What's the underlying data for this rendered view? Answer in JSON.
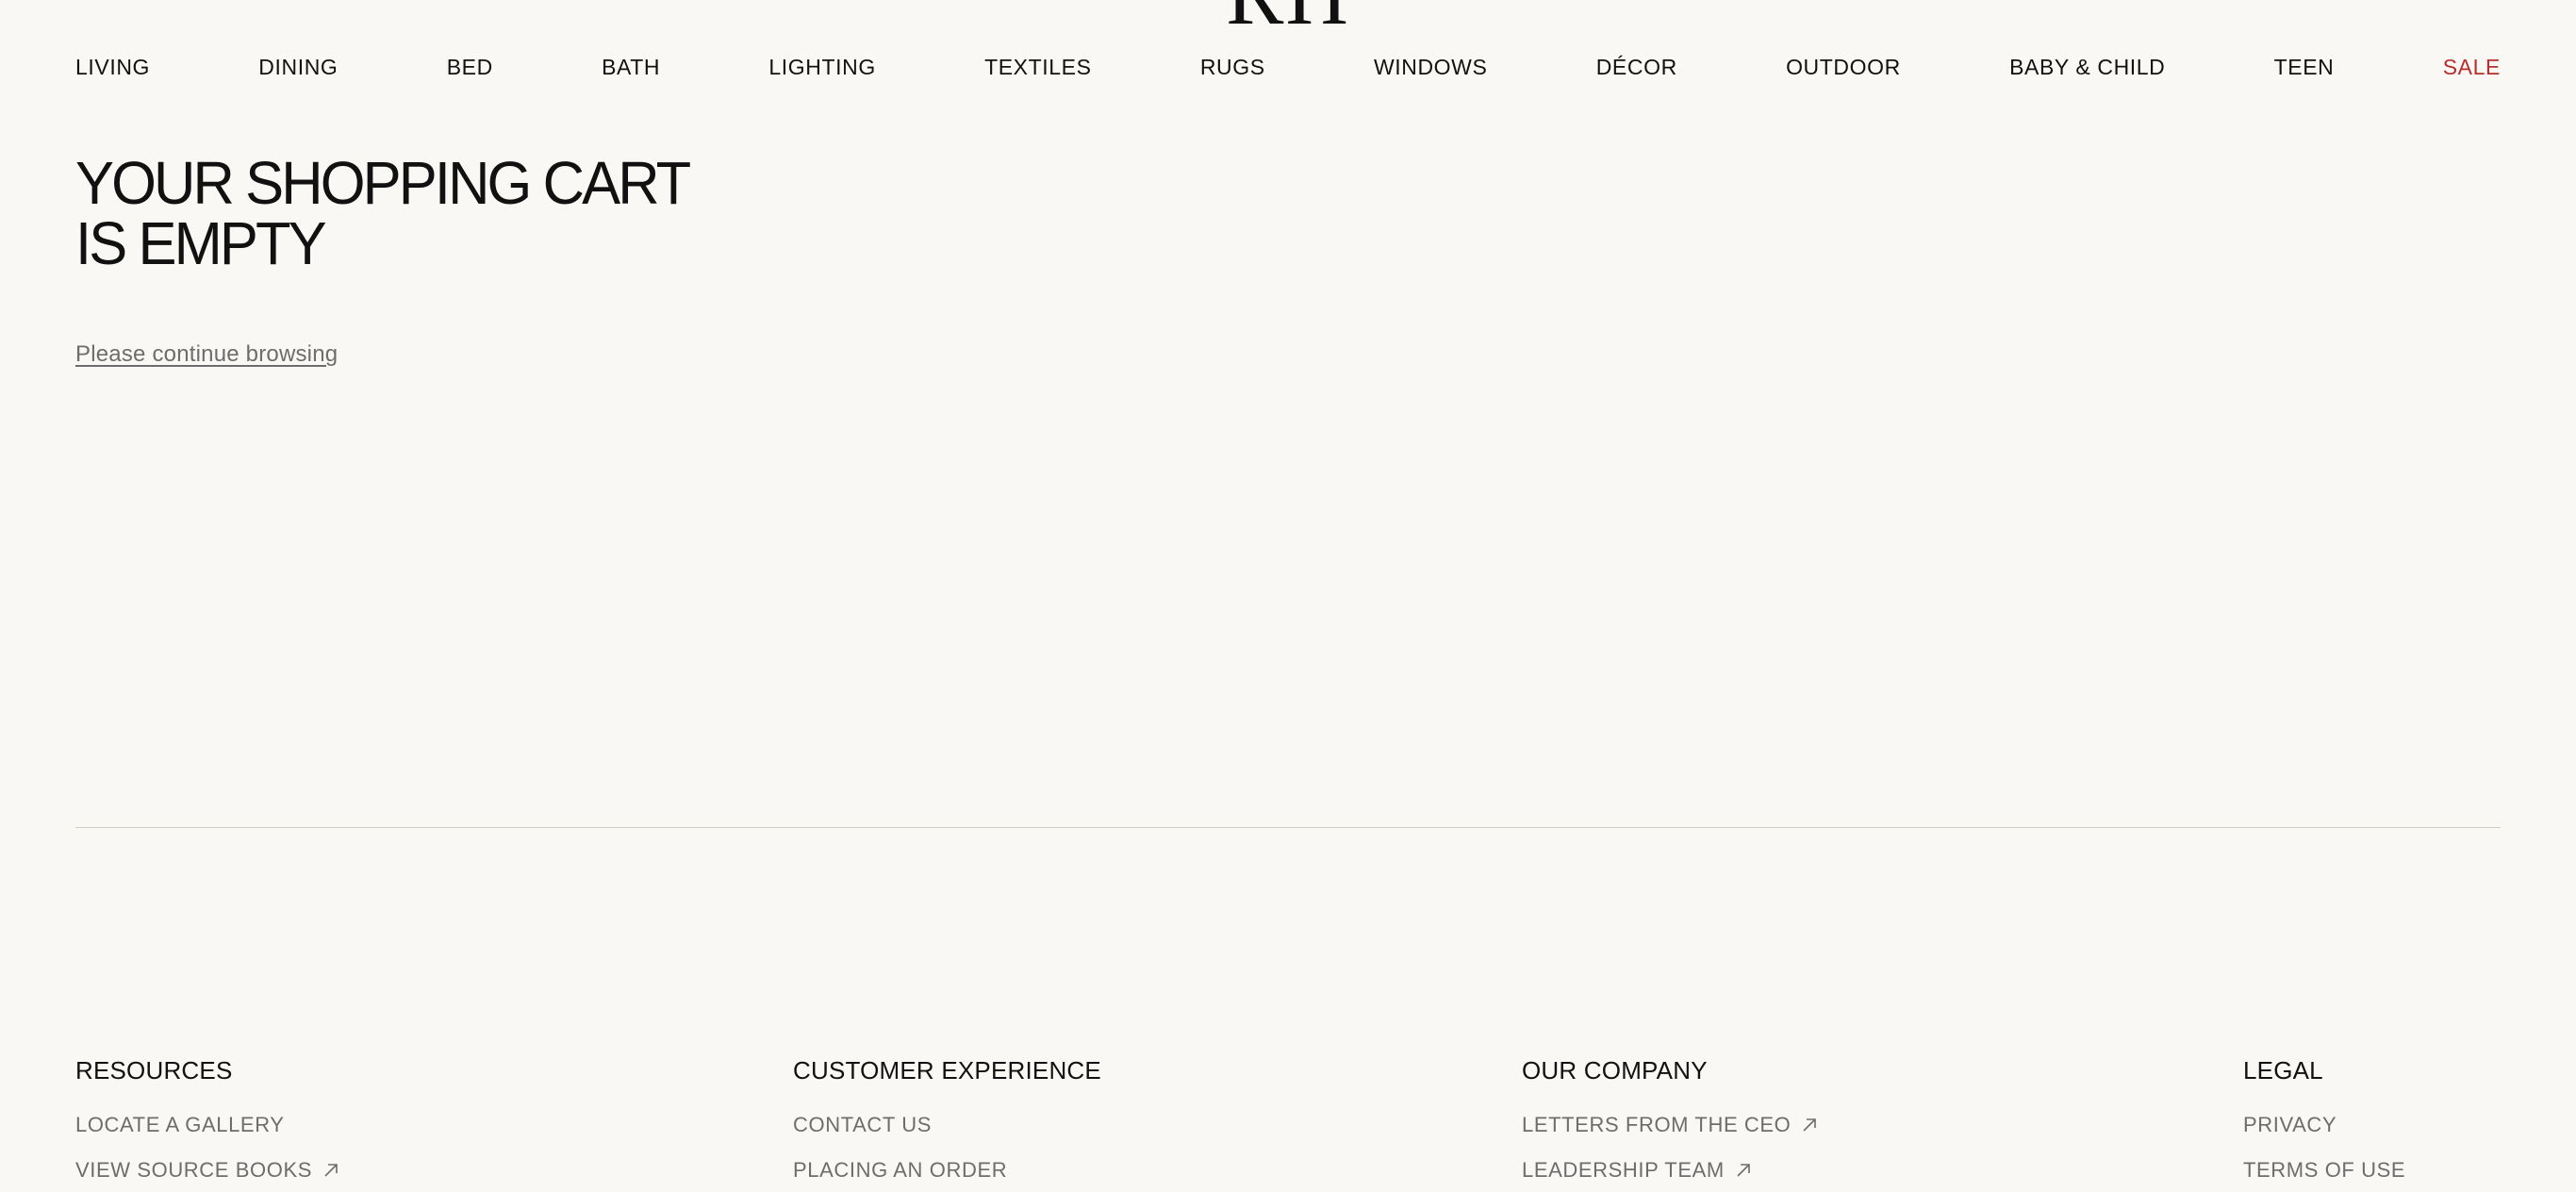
{
  "brand": {
    "logo_text": "RH"
  },
  "nav": {
    "items": [
      {
        "label": "LIVING"
      },
      {
        "label": "DINING"
      },
      {
        "label": "BED"
      },
      {
        "label": "BATH"
      },
      {
        "label": "LIGHTING"
      },
      {
        "label": "TEXTILES"
      },
      {
        "label": "RUGS"
      },
      {
        "label": "WINDOWS"
      },
      {
        "label": "DÉCOR"
      },
      {
        "label": "OUTDOOR"
      },
      {
        "label": "BABY & CHILD"
      },
      {
        "label": "TEEN"
      },
      {
        "label": "SALE"
      }
    ],
    "sale_color": "#b92d2d"
  },
  "cart": {
    "title": "YOUR SHOPPING CART IS EMPTY",
    "continue_link": "Please continue browsing"
  },
  "footer": {
    "columns": [
      {
        "heading": "RESOURCES",
        "links": [
          {
            "label": "LOCATE A GALLERY",
            "icon": ""
          },
          {
            "label": "VIEW SOURCE BOOKS",
            "icon": "external-link-icon"
          }
        ]
      },
      {
        "heading": "CUSTOMER EXPERIENCE",
        "links": [
          {
            "label": "CONTACT US",
            "icon": ""
          },
          {
            "label": "PLACING AN ORDER",
            "icon": ""
          }
        ]
      },
      {
        "heading": "OUR COMPANY",
        "links": [
          {
            "label": "LETTERS FROM THE CEO",
            "icon": "external-link-icon"
          },
          {
            "label": "LEADERSHIP TEAM",
            "icon": "external-link-icon"
          }
        ]
      },
      {
        "heading": "LEGAL",
        "links": [
          {
            "label": "PRIVACY",
            "icon": ""
          },
          {
            "label": "TERMS OF USE",
            "icon": ""
          }
        ]
      }
    ]
  },
  "colors": {
    "background": "#f9f8f5",
    "text": "#111111",
    "muted_text": "#6d6d6d",
    "divider": "#cfccc6"
  }
}
